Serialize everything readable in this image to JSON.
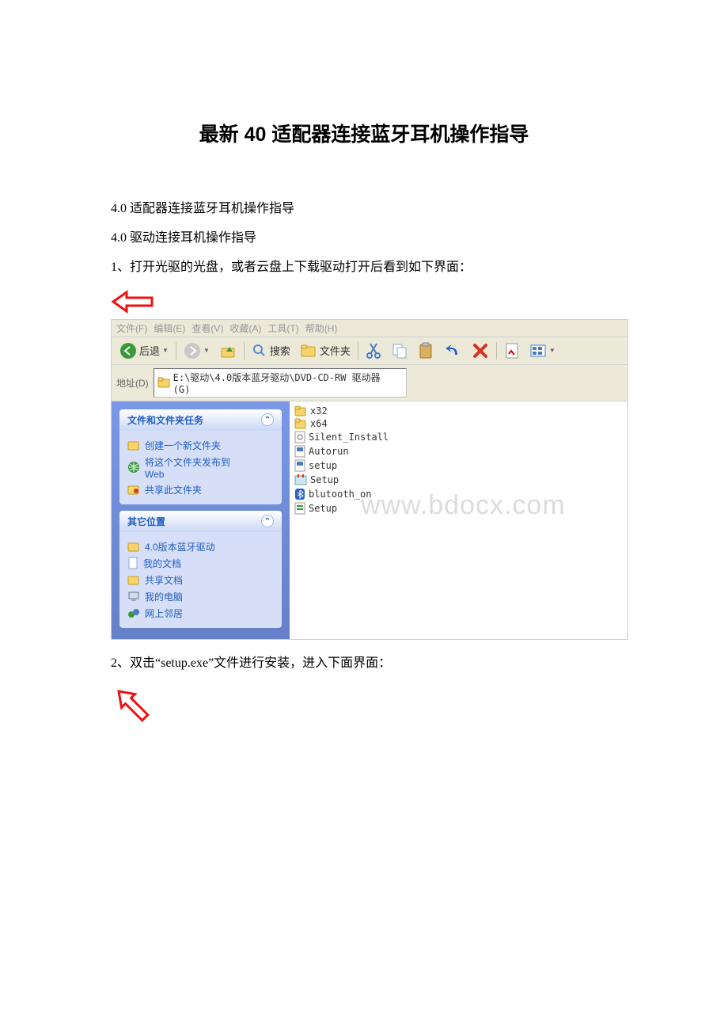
{
  "title": "最新 40 适配器连接蓝牙耳机操作指导",
  "para1": "4.0 适配器连接蓝牙耳机操作指导",
  "para2": "4.0 驱动连接耳机操作指导",
  "para3": "1、打开光驱的光盘，或者云盘上下载驱动打开后看到如下界面：",
  "para4": "2、双击“setup.exe”文件进行安装，进入下面界面：",
  "watermark": "www.bdocx.com",
  "window": {
    "menus": [
      "文件(F)",
      "编辑(E)",
      "查看(V)",
      "收藏(A)",
      "工具(T)",
      "帮助(H)"
    ],
    "back": "后退",
    "search": "搜索",
    "folders": "文件夹",
    "address_label": "地址(D)",
    "address_path": "E:\\驱动\\4.0版本蓝牙驱动\\DVD-CD-RW 驱动器 (G)",
    "tasks_title": "文件和文件夹任务",
    "tasks": [
      {
        "icon": "folder-new",
        "label": "创建一个新文件夹"
      },
      {
        "icon": "globe",
        "label": "将这个文件夹发布到\nWeb"
      },
      {
        "icon": "share",
        "label": "共享此文件夹"
      }
    ],
    "other_title": "其它位置",
    "others": [
      {
        "icon": "folder",
        "label": "4.0版本蓝牙驱动"
      },
      {
        "icon": "doc",
        "label": "我的文档"
      },
      {
        "icon": "folder",
        "label": "共享文档"
      },
      {
        "icon": "computer",
        "label": "我的电脑"
      },
      {
        "icon": "network",
        "label": "网上邻居"
      }
    ],
    "files": [
      {
        "type": "folder",
        "name": "x32"
      },
      {
        "type": "folder",
        "name": "x64"
      },
      {
        "type": "ini",
        "name": "Silent_Install"
      },
      {
        "type": "exe",
        "name": "Autorun"
      },
      {
        "type": "exe",
        "name": "setup"
      },
      {
        "type": "msi",
        "name": "Setup"
      },
      {
        "type": "bt",
        "name": "blutooth_on"
      },
      {
        "type": "cfg",
        "name": "Setup"
      }
    ]
  }
}
